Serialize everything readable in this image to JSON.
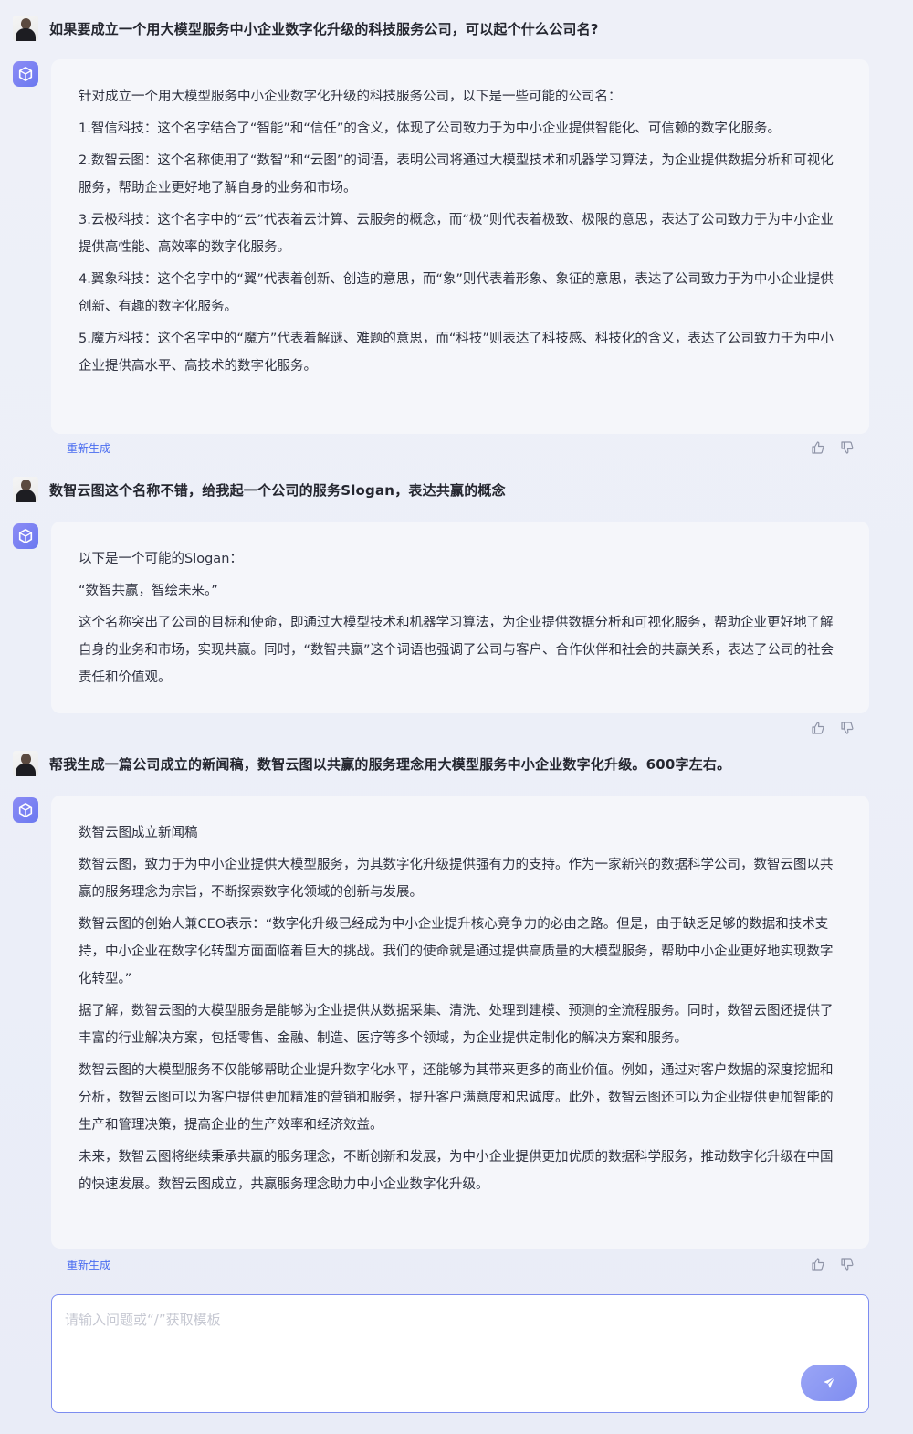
{
  "conversation": [
    {
      "question": "如果要成立一个用大模型服务中小企业数字化升级的科技服务公司，可以起个什么公司名?",
      "answer": [
        "针对成立一个用大模型服务中小企业数字化升级的科技服务公司，以下是一些可能的公司名：",
        "1.智信科技：这个名字结合了“智能”和“信任”的含义，体现了公司致力于为中小企业提供智能化、可信赖的数字化服务。",
        "2.数智云图：这个名称使用了“数智”和“云图”的词语，表明公司将通过大模型技术和机器学习算法，为企业提供数据分析和可视化服务，帮助企业更好地了解自身的业务和市场。",
        "3.云极科技：这个名字中的“云”代表着云计算、云服务的概念，而“极”则代表着极致、极限的意思，表达了公司致力于为中小企业提供高性能、高效率的数字化服务。",
        "4.翼象科技：这个名字中的“翼”代表着创新、创造的意思，而“象”则代表着形象、象征的意思，表达了公司致力于为中小企业提供创新、有趣的数字化服务。",
        "5.魔方科技：这个名字中的“魔方”代表着解谜、难题的意思，而“科技”则表达了科技感、科技化的含义，表达了公司致力于为中小企业提供高水平、高技术的数字化服务。"
      ],
      "regenerate_label": "重新生成"
    },
    {
      "question": "数智云图这个名称不错，给我起一个公司的服务Slogan，表达共赢的概念",
      "answer": [
        "以下是一个可能的Slogan：",
        "“数智共赢，智绘未来。”",
        "这个名称突出了公司的目标和使命，即通过大模型技术和机器学习算法，为企业提供数据分析和可视化服务，帮助企业更好地了解自身的业务和市场，实现共赢。同时，“数智共赢”这个词语也强调了公司与客户、合作伙伴和社会的共赢关系，表达了公司的社会责任和价值观。"
      ],
      "regenerate_label": ""
    },
    {
      "question": "帮我生成一篇公司成立的新闻稿，数智云图以共赢的服务理念用大模型服务中小企业数字化升级。600字左右。",
      "answer": [
        "数智云图成立新闻稿",
        "数智云图，致力于为中小企业提供大模型服务，为其数字化升级提供强有力的支持。作为一家新兴的数据科学公司，数智云图以共赢的服务理念为宗旨，不断探索数字化领域的创新与发展。",
        "数智云图的创始人兼CEO表示：“数字化升级已经成为中小企业提升核心竞争力的必由之路。但是，由于缺乏足够的数据和技术支持，中小企业在数字化转型方面面临着巨大的挑战。我们的使命就是通过提供高质量的大模型服务，帮助中小企业更好地实现数字化转型。”",
        "据了解，数智云图的大模型服务是能够为企业提供从数据采集、清洗、处理到建模、预测的全流程服务。同时，数智云图还提供了丰富的行业解决方案，包括零售、金融、制造、医疗等多个领域，为企业提供定制化的解决方案和服务。",
        "数智云图的大模型服务不仅能够帮助企业提升数字化水平，还能够为其带来更多的商业价值。例如，通过对客户数据的深度挖掘和分析，数智云图可以为客户提供更加精准的营销和服务，提升客户满意度和忠诚度。此外，数智云图还可以为企业提供更加智能的生产和管理决策，提高企业的生产效率和经济效益。",
        "未来，数智云图将继续秉承共赢的服务理念，不断创新和发展，为中小企业提供更加优质的数据科学服务，推动数字化升级在中国的快速发展。数智云图成立，共赢服务理念助力中小企业数字化升级。"
      ],
      "regenerate_label": "重新生成"
    }
  ],
  "input": {
    "placeholder": "请输入问题或“/”获取模板"
  },
  "icons": {
    "user_avatar": "user-avatar",
    "bot": "cube-icon",
    "like": "thumbs-up-icon",
    "dislike": "thumbs-down-icon",
    "send": "send-icon"
  },
  "colors": {
    "accent": "#6a78f0",
    "link": "#4a6cf0",
    "input_border": "#7c8cf0"
  }
}
